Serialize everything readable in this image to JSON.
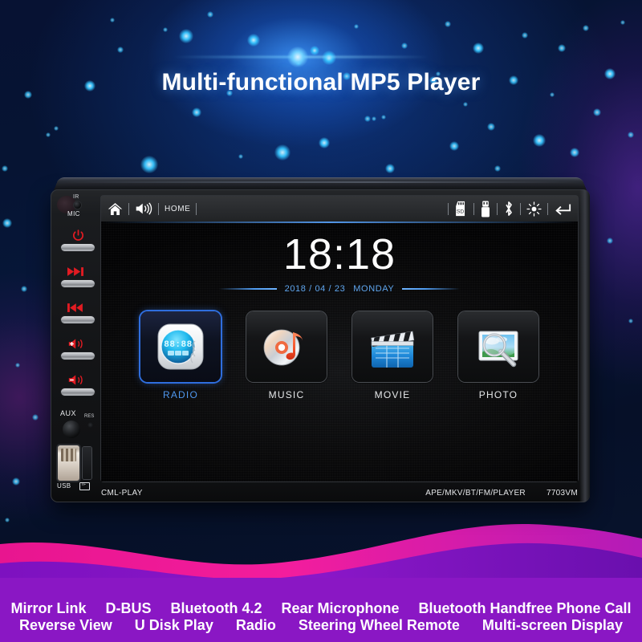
{
  "page": {
    "title": "Multi-functional MP5 Player"
  },
  "theme": {
    "accent_blue": "#4f97ee",
    "bg_deep_blue": "#071233",
    "wave_magenta": "#ec1f9a",
    "wave_purple": "#8a17c4",
    "button_red": "#e11b22"
  },
  "device": {
    "left_panel": {
      "ir_label": "IR",
      "mic_label": "MIC",
      "aux_label": "AUX",
      "reset_label": "RES",
      "usb_label": "USB",
      "tf_label": "TF",
      "buttons": [
        {
          "name": "power",
          "icon": "power-icon"
        },
        {
          "name": "next-track",
          "icon": "next-track-icon"
        },
        {
          "name": "previous-track",
          "icon": "previous-track-icon"
        },
        {
          "name": "volume-up",
          "icon": "volume-up-icon"
        },
        {
          "name": "volume-down",
          "icon": "volume-down-icon"
        }
      ]
    },
    "topbar": {
      "home_icon": "home-icon",
      "volume_icon": "volume-icon",
      "home_label": "HOME",
      "right_icons": [
        {
          "name": "sd-card-icon",
          "label": "SD"
        },
        {
          "name": "usb-icon",
          "label": "USB"
        },
        {
          "name": "bluetooth-icon",
          "label": "Bluetooth"
        },
        {
          "name": "brightness-icon",
          "label": "Brightness"
        },
        {
          "name": "back-arrow-icon",
          "label": "Back"
        }
      ]
    },
    "screen": {
      "clock": "18:18",
      "date": "2018 / 04 / 23",
      "weekday": "MONDAY",
      "apps": [
        {
          "label": "RADIO",
          "icon": "radio-clock-icon",
          "selected": true,
          "display": "88:88"
        },
        {
          "label": "MUSIC",
          "icon": "cd-music-note-icon",
          "selected": false
        },
        {
          "label": "MOVIE",
          "icon": "clapperboard-icon",
          "selected": false
        },
        {
          "label": "PHOTO",
          "icon": "photo-magnifier-icon",
          "selected": false
        }
      ]
    },
    "footer": {
      "brand": "CML-PLAY",
      "formats": "APE/MKV/BT/FM/PLAYER",
      "model": "7703VM"
    }
  },
  "features": {
    "row1": [
      "Mirror Link",
      "D-BUS",
      "Bluetooth 4.2",
      "Rear Microphone",
      "Bluetooth Handfree Phone Call"
    ],
    "row2": [
      "Reverse View",
      "U Disk Play",
      "Radio",
      "Steering Wheel Remote",
      "Multi-screen Display"
    ]
  }
}
